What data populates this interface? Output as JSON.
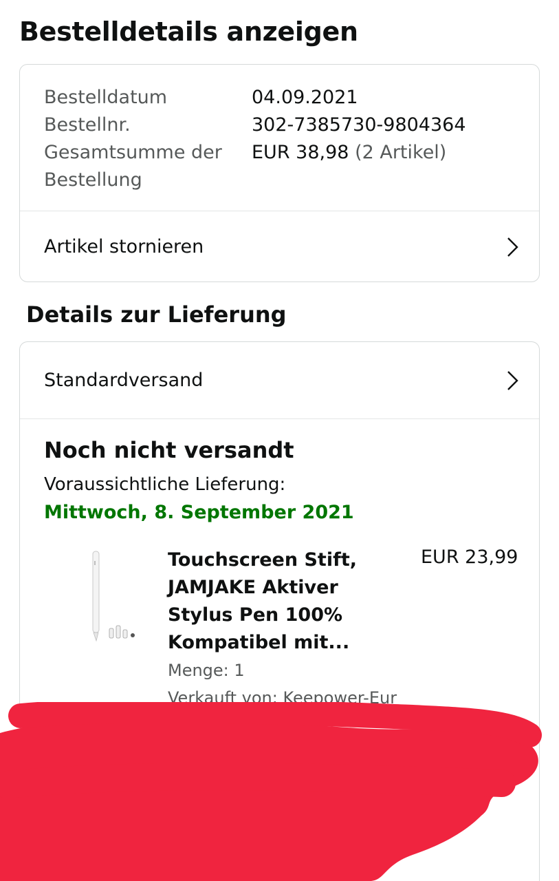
{
  "page_title": "Bestelldetails anzeigen",
  "summary": {
    "rows": [
      {
        "label": "Bestelldatum",
        "value": "04.09.2021"
      },
      {
        "label": "Bestellnr.",
        "value": "302-7385730-9804364"
      }
    ],
    "total_label_line1": "Gesamtsumme der",
    "total_label_line2": "Bestellung",
    "total_value": "EUR 38,98",
    "total_items": "(2 Artikel)",
    "cancel_label": "Artikel stornieren"
  },
  "delivery": {
    "section_title": "Details zur Lieferung",
    "shipping_label": "Standardversand",
    "status": "Noch nicht versandt",
    "eta_label": "Voraussichtliche Lieferung:",
    "eta_date": "Mittwoch, 8. September 2021",
    "eta_color": "#007600"
  },
  "product": {
    "title_lines": [
      "Touchscreen Stift,",
      "JAMJAKE Aktiver",
      "Stylus Pen 100%",
      "Kompatibel mit..."
    ],
    "price": "EUR 23,99",
    "quantity": "Menge: 1",
    "seller": "Verkauft von: Keepower-Eur"
  },
  "colors": {
    "redaction": "#f0243f",
    "border": "#d5d9d9",
    "muted_text": "#565959"
  }
}
